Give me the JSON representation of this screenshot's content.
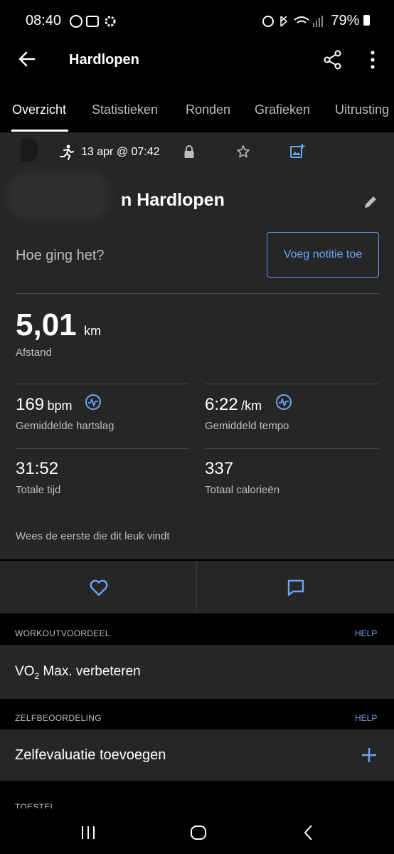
{
  "status_bar": {
    "time": "08:40",
    "battery": "79%"
  },
  "app_bar": {
    "title": "Hardlopen"
  },
  "tabs": [
    {
      "label": "Overzicht"
    },
    {
      "label": "Statistieken"
    },
    {
      "label": "Ronden"
    },
    {
      "label": "Grafieken"
    },
    {
      "label": "Uitrusting"
    }
  ],
  "activity": {
    "date": "13 apr @ 07:42",
    "name": "n Hardlopen",
    "prompt": "Hoe ging het?",
    "note_button": "Voeg notitie toe"
  },
  "metrics": {
    "distance": {
      "value": "5,01",
      "unit": "km",
      "label": "Afstand"
    },
    "heart_rate": {
      "value": "169",
      "unit": "bpm",
      "label": "Gemiddelde hartslag"
    },
    "pace": {
      "value": "6:22",
      "unit": "/km",
      "label": "Gemiddeld tempo"
    },
    "time": {
      "value": "31:52",
      "label": "Totale tijd"
    },
    "calories": {
      "value": "337",
      "label": "Totaal calorieën"
    }
  },
  "likes_text": "Wees de eerste die dit leuk vindt",
  "sections": {
    "workout": {
      "header": "WORKOUTVOORDEEL",
      "help": "HELP",
      "value_main": "VO",
      "value_sub": "2",
      "value_rest": " Max. verbeteren"
    },
    "self_eval": {
      "header": "ZELFBEOORDELING",
      "help": "HELP",
      "value": "Zelfevaluatie toevoegen"
    },
    "device": {
      "header": "TOESTEL"
    }
  },
  "colors": {
    "accent": "#6aa6f2",
    "card": "#262626",
    "background": "#000000"
  }
}
